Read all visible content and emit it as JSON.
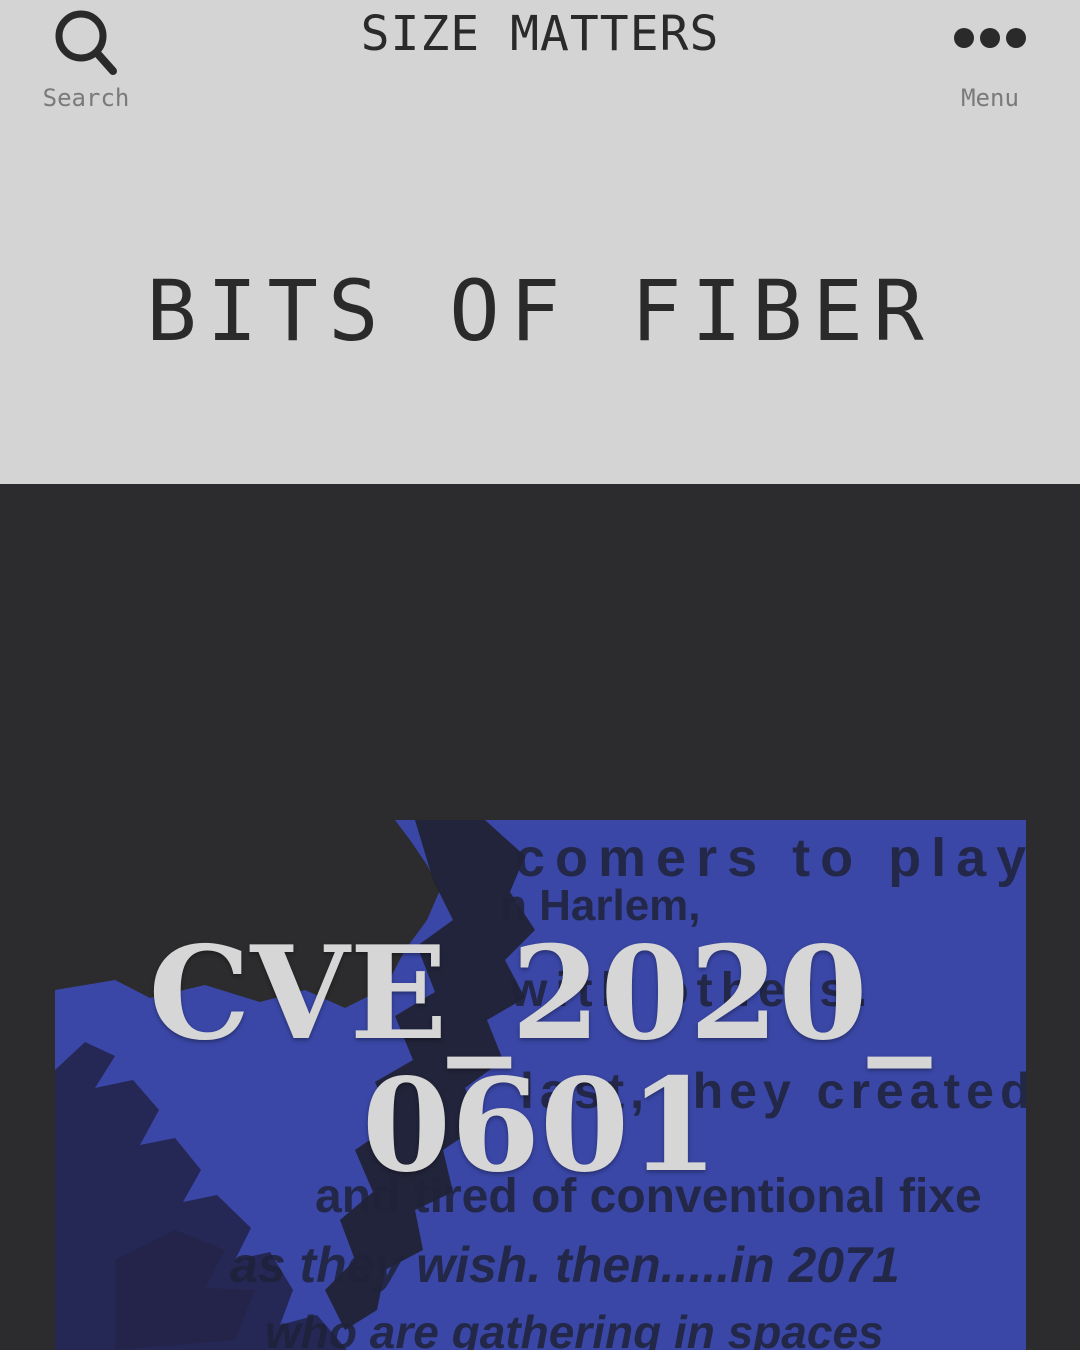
{
  "header": {
    "site_title": "SIZE MATTERS",
    "search_label": "Search",
    "menu_label": "Menu",
    "search_icon": "search-icon",
    "menu_icon": "ellipsis-icon"
  },
  "page": {
    "title": "BITS OF FIBER"
  },
  "hero": {
    "title_line1": "CVE_2020_",
    "title_line2": "0601",
    "image_text": {
      "line1": "comers to play,",
      "line2": "n Harlem,",
      "line3": "with others.",
      "line4": "last, they created",
      "line5": "and tired of conventional fixe",
      "line6": "as they wish.  then.....in 2071",
      "line7": "who are gathering in spaces"
    }
  },
  "colors": {
    "header_bg": "#d4d4d4",
    "dark_bg": "#2c2c2e",
    "header_text": "#2a2a2a",
    "label_text": "#7a7a7a",
    "image_blue": "#3a47a6",
    "hero_text": "#d6d6d6"
  }
}
